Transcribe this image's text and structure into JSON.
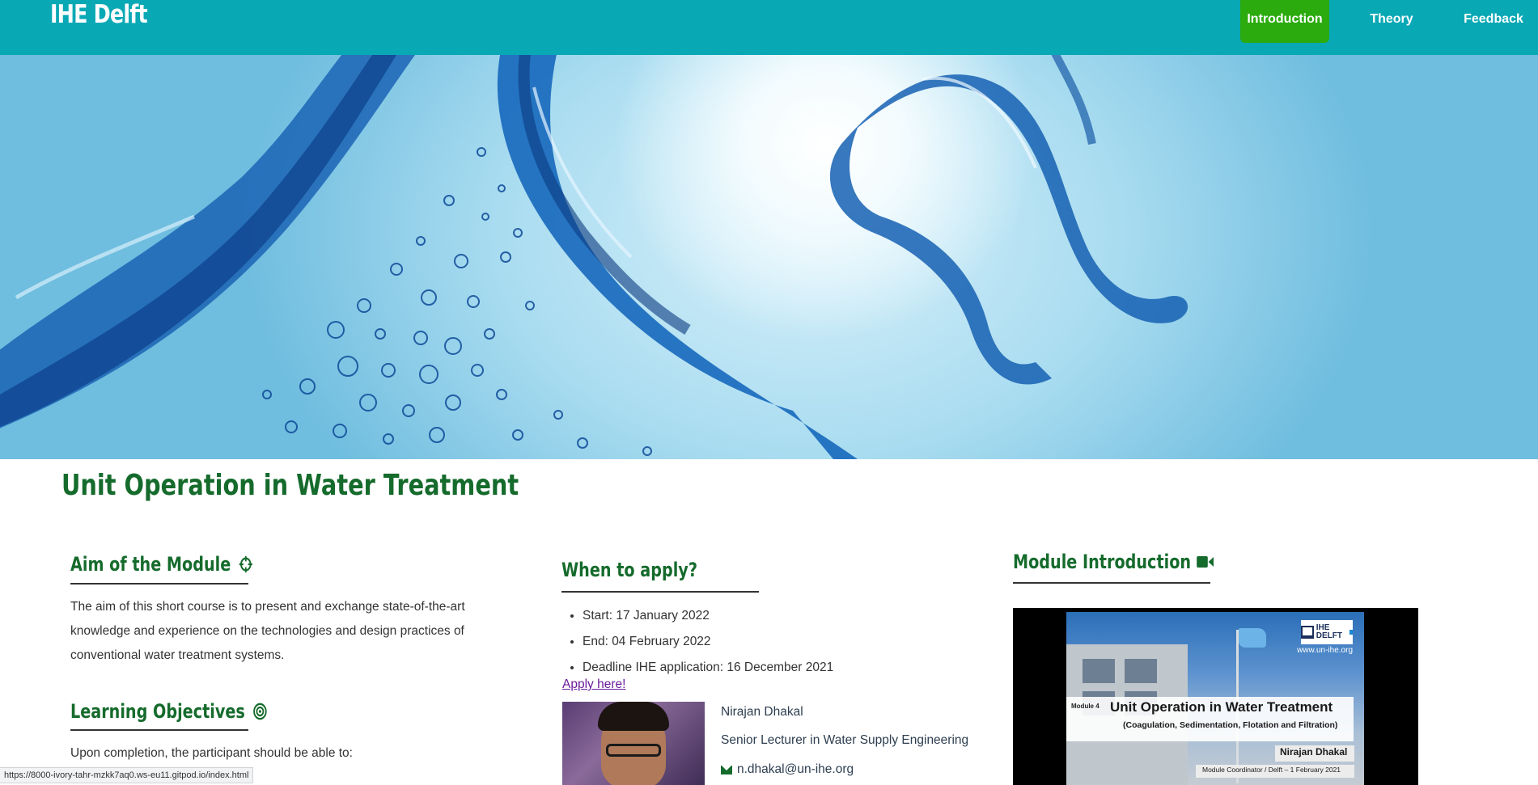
{
  "navbar": {
    "brand": "IHE Delft",
    "items": [
      {
        "label": "Introduction",
        "active": true
      },
      {
        "label": "Theory",
        "active": false
      },
      {
        "label": "Feedback",
        "active": false
      }
    ],
    "color": "#09a8b5",
    "active_color": "#2bab0e"
  },
  "page": {
    "title": "Unit Operation in Water Treatment"
  },
  "aim": {
    "heading": "Aim of the Module",
    "icon": "crosshair-icon",
    "text": "The aim of this short course is to present and exchange state-of-the-art knowledge and experience on the technologies and design practices of conventional water treatment systems."
  },
  "learning_objectives": {
    "heading": "Learning Objectives",
    "icon": "bullseye-icon",
    "text": "Upon completion, the participant should be able to:"
  },
  "when_to_apply": {
    "heading": "When to apply?",
    "items": [
      "Start: 17 January 2022",
      "End: 04 February 2022",
      "Deadline IHE application: 16 December 2021"
    ],
    "apply_link": "Apply here!"
  },
  "person": {
    "name": "Nirajan Dhakal",
    "role": "Senior Lecturer in Water Supply Engineering",
    "email": "n.dhakal@un-ihe.org"
  },
  "module_intro": {
    "heading": "Module Introduction",
    "icon": "video-camera-icon",
    "video": {
      "logo_text": "IHE DELFT",
      "website": "www.un-ihe.org",
      "module_label": "Module 4",
      "title": "Unit Operation in Water Treatment",
      "subtitle": "(Coagulation, Sedimentation, Flotation and Filtration)",
      "presenter": "Nirajan Dhakal",
      "coordinator": "Module Coordinator / Delft – 1 February 2021"
    }
  },
  "status_bar": {
    "url": "https://8000-ivory-tahr-mzkk7aq0.ws-eu11.gitpod.io/index.html"
  },
  "colors": {
    "heading_green": "#156b2c",
    "link_purple": "#6a1b9a"
  }
}
